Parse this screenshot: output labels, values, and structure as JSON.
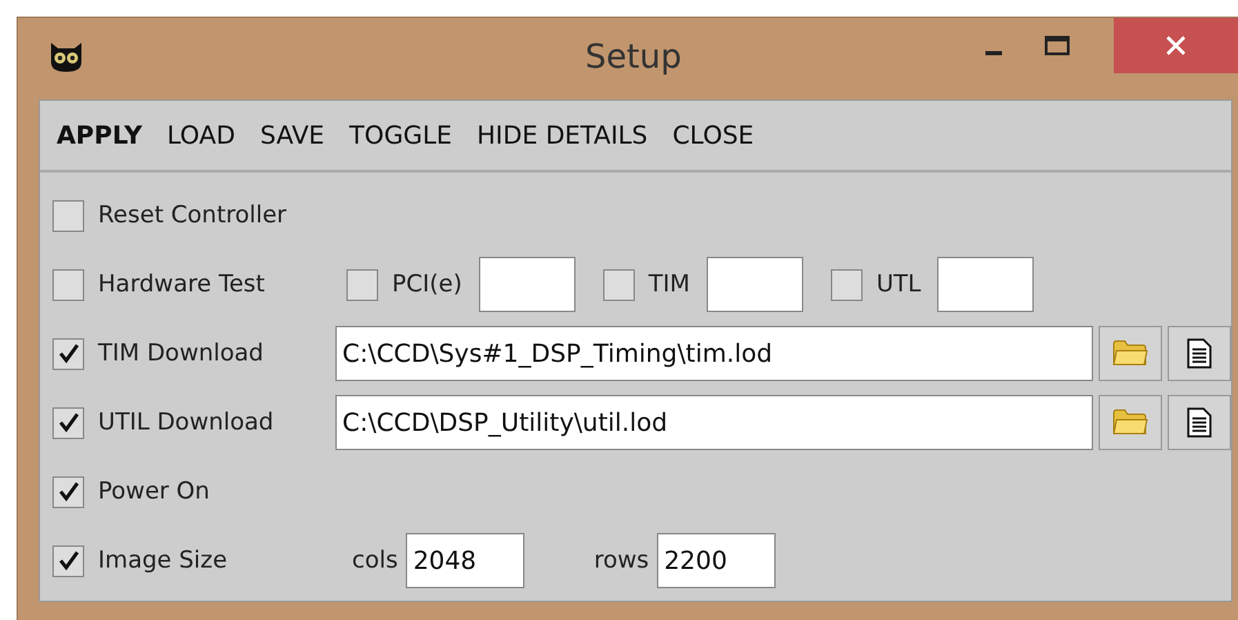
{
  "window": {
    "title": "Setup"
  },
  "menu": [
    {
      "label": "APPLY",
      "bold": true
    },
    {
      "label": "LOAD",
      "bold": false
    },
    {
      "label": "SAVE",
      "bold": false
    },
    {
      "label": "TOGGLE",
      "bold": false
    },
    {
      "label": "HIDE DETAILS",
      "bold": false
    },
    {
      "label": "CLOSE",
      "bold": false
    }
  ],
  "rows": [
    {
      "kind": "check",
      "label": "Reset Controller",
      "checked": false
    },
    {
      "kind": "test",
      "label": "Hardware Test",
      "checked": false,
      "options": [
        {
          "label": "PCI(e)",
          "checked": false
        },
        {
          "label": "TIM",
          "checked": false
        },
        {
          "label": "UTL",
          "checked": false
        }
      ]
    },
    {
      "kind": "file",
      "label": "TIM Download",
      "checked": true,
      "path": "C:\\CCD\\Sys#1_DSP_Timing\\tim.lod"
    },
    {
      "kind": "file",
      "label": "UTIL Download",
      "checked": true,
      "path": "C:\\CCD\\DSP_Utility\\util.lod"
    },
    {
      "kind": "check",
      "label": "Power On",
      "checked": true
    },
    {
      "kind": "size",
      "label": "Image Size",
      "checked": true,
      "fields": [
        {
          "label": "cols",
          "value": "2048"
        },
        {
          "label": "rows",
          "value": "2200"
        }
      ]
    }
  ]
}
